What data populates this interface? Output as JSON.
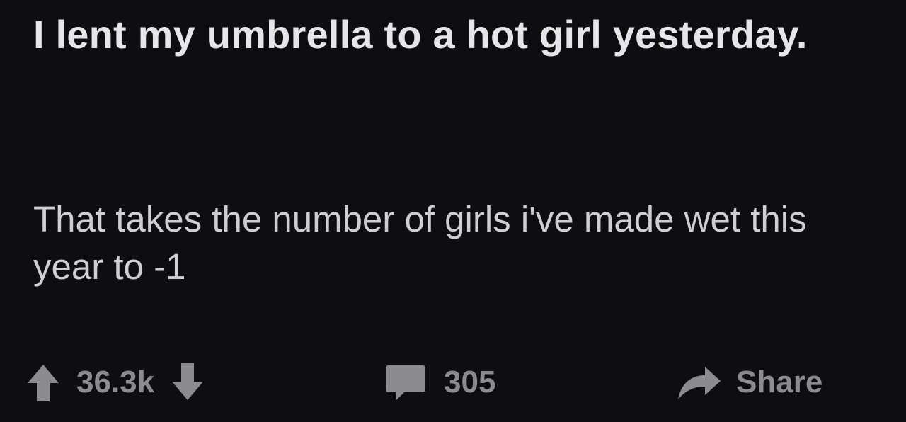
{
  "post": {
    "title": "I lent my umbrella to a hot girl yesterday.",
    "body": "That takes the number of girls i've made wet this year to -1"
  },
  "actions": {
    "score": "36.3k",
    "comments_count": "305",
    "share_label": "Share"
  },
  "colors": {
    "background": "#0e0d0f",
    "title": "#e6e5e8",
    "body": "#cfced2",
    "muted": "#8c8b8f"
  },
  "icons": {
    "upvote": "arrow-up-icon",
    "downvote": "arrow-down-icon",
    "comments": "comment-bubble-icon",
    "share": "share-arrow-icon"
  }
}
